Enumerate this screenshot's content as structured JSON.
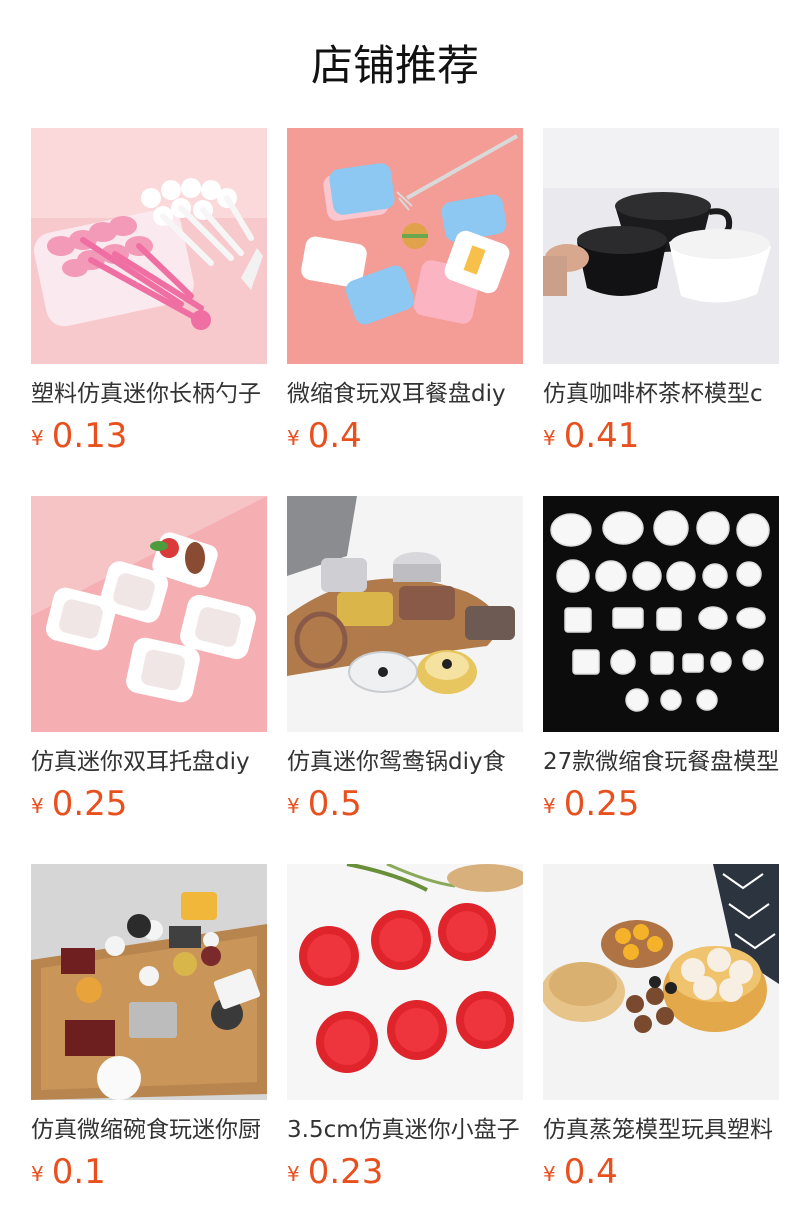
{
  "page": {
    "title": "店铺推荐"
  },
  "currency": "¥",
  "products": [
    {
      "name": "塑料仿真迷你长柄勺子",
      "price": "0.13",
      "image": "pink-spoons"
    },
    {
      "name": "微缩食玩双耳餐盘diy",
      "price": "0.4",
      "image": "colored-trays"
    },
    {
      "name": "仿真咖啡杯茶杯模型c",
      "price": "0.41",
      "image": "black-white-cups"
    },
    {
      "name": "仿真迷你双耳托盘diy",
      "price": "0.25",
      "image": "white-trays"
    },
    {
      "name": "仿真迷你鸳鸯锅diy食",
      "price": "0.5",
      "image": "hotpots"
    },
    {
      "name": "27款微缩食玩餐盘模型",
      "price": "0.25",
      "image": "white-plates-on-black"
    },
    {
      "name": "仿真微缩碗食玩迷你厨",
      "price": "0.1",
      "image": "kitchen-set-on-tray"
    },
    {
      "name": "3.5cm仿真迷你小盘子",
      "price": "0.23",
      "image": "red-plates"
    },
    {
      "name": "仿真蒸笼模型玩具塑料",
      "price": "0.4",
      "image": "steamers-with-buns"
    }
  ]
}
